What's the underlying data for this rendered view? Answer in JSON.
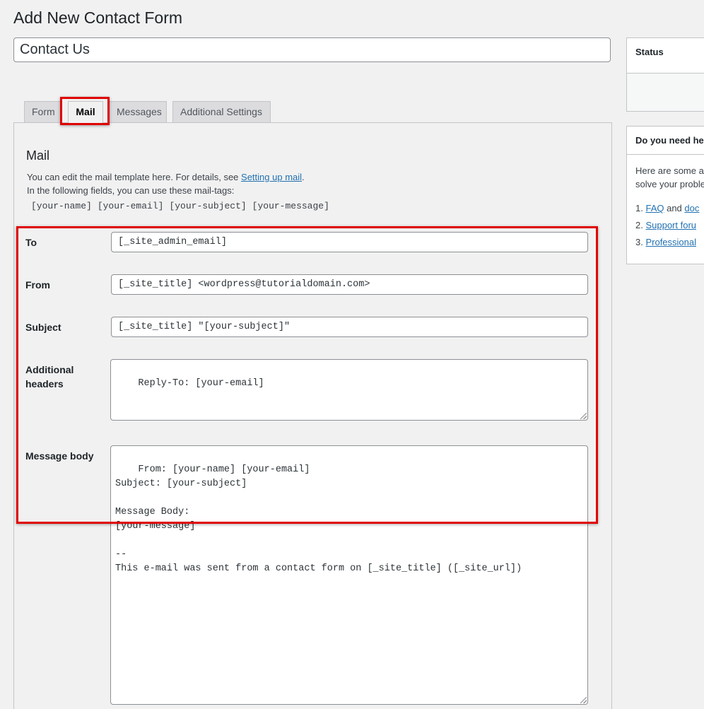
{
  "page": {
    "title": "Add New Contact Form",
    "form_title_value": "Contact Us"
  },
  "tabs": [
    {
      "label": "Form"
    },
    {
      "label": "Mail"
    },
    {
      "label": "Messages"
    },
    {
      "label": "Additional Settings"
    }
  ],
  "mail": {
    "heading": "Mail",
    "desc_prefix": "You can edit the mail template here. For details, see ",
    "desc_link": "Setting up mail",
    "desc_suffix": ".",
    "desc_line2": "In the following fields, you can use these mail-tags:",
    "mail_tags": [
      "[your-name]",
      "[your-email]",
      "[your-subject]",
      "[your-message]"
    ],
    "fields": {
      "to": {
        "label": "To",
        "value": "[_site_admin_email]"
      },
      "from": {
        "label": "From",
        "value": "[_site_title] <wordpress@tutorialdomain.com>"
      },
      "subject": {
        "label": "Subject",
        "value": "[_site_title] \"[your-subject]\""
      },
      "additional_headers": {
        "label_line1": "Additional",
        "label_line2": "headers",
        "value": "Reply-To: [your-email]"
      },
      "message_body": {
        "label": "Message body",
        "value": "From: [your-name] [your-email]\nSubject: [your-subject]\n\nMessage Body:\n[your-message]\n\n--\nThis e-mail was sent from a contact form on [_site_title] ([_site_url])"
      }
    }
  },
  "sidebar": {
    "status_title": "Status",
    "help_title": "Do you need he",
    "help_line1": "Here are some av",
    "help_line2": "solve your proble",
    "help_items": [
      {
        "num": "1.",
        "link1": "FAQ",
        "mid": " and ",
        "link2": "doc"
      },
      {
        "num": "2.",
        "link1": "Support foru"
      },
      {
        "num": "3.",
        "link1": "Professional"
      }
    ]
  },
  "colors": {
    "highlight": "#e00000",
    "link": "#2271b1",
    "background": "#f1f1f1"
  }
}
